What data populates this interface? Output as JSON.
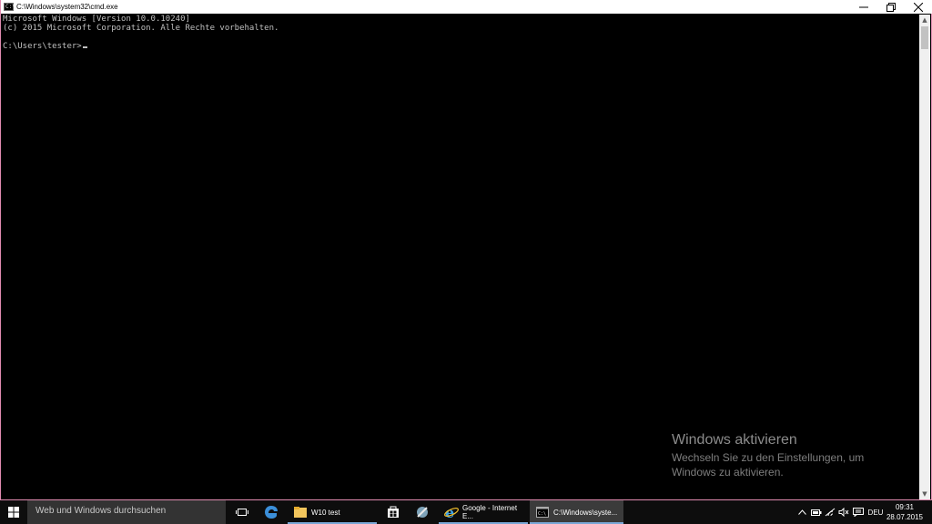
{
  "window": {
    "title": "C:\\Windows\\system32\\cmd.exe",
    "icon": "cmd-icon",
    "controls": {
      "minimize": "minimize-icon",
      "restore": "restore-icon",
      "close": "close-icon"
    }
  },
  "console": {
    "lines": [
      "Microsoft Windows [Version 10.0.10240]",
      "(c) 2015 Microsoft Corporation. Alle Rechte vorbehalten.",
      "",
      "C:\\Users\\tester>"
    ],
    "text_color": "#c0c0c0",
    "background": "#000000"
  },
  "watermark": {
    "title": "Windows aktivieren",
    "text": "Wechseln Sie zu den Einstellungen, um Windows zu aktivieren."
  },
  "taskbar": {
    "search_placeholder": "Web und Windows durchsuchen",
    "apps": [
      {
        "label": "W10 test",
        "icon": "folder-icon"
      },
      {
        "label": "Google - Internet E...",
        "icon": "internet-explorer-icon"
      },
      {
        "label": "C:\\Windows\\syste...",
        "icon": "cmd-icon",
        "active": true
      }
    ],
    "pinned": [
      "task-view-icon",
      "edge-icon",
      "store-icon",
      "tool-icon"
    ],
    "tray": {
      "language": "DEU",
      "time": "09:31",
      "date": "28.07.2015"
    },
    "accent": "#79a7d6"
  }
}
